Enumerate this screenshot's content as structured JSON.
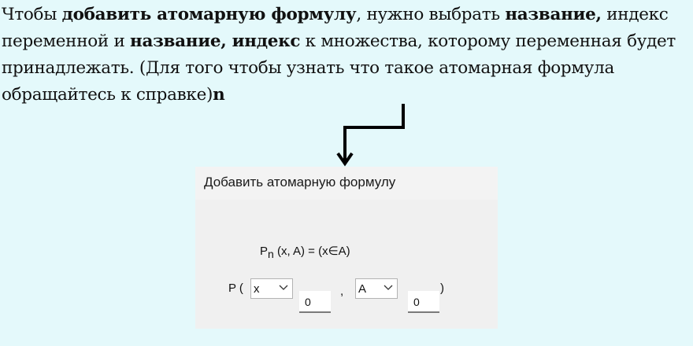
{
  "help": {
    "p1": "Чтобы ",
    "b1": "добавить атомарную формулу",
    "p2": ", нужно выбрать ",
    "b2": "название,",
    "p3": " индекс переменной и ",
    "b3": "название, индекс",
    "p4": " к множества, которому переменная будет принадлежать. (Для того чтобы узнать что такое атомарная формула обращайтесь к справке)",
    "b4": "n"
  },
  "dialog": {
    "title": "Добавить атомарную формулу",
    "formula_base": "P",
    "formula_sub": "n",
    "formula_rest": " (x, A) = (x∈A)",
    "p_label": "P (",
    "variable_select": "x",
    "variable_index": "0",
    "comma": ",",
    "set_select": "A",
    "set_index": "0",
    "close_paren": ")"
  },
  "colors": {
    "background": "#e4f9fb",
    "dialog": "#f0f0f0",
    "arrow": "#000000"
  },
  "icons": {
    "arrow": "bent-arrow-down-icon",
    "dropdown": "chevron-down-icon"
  }
}
